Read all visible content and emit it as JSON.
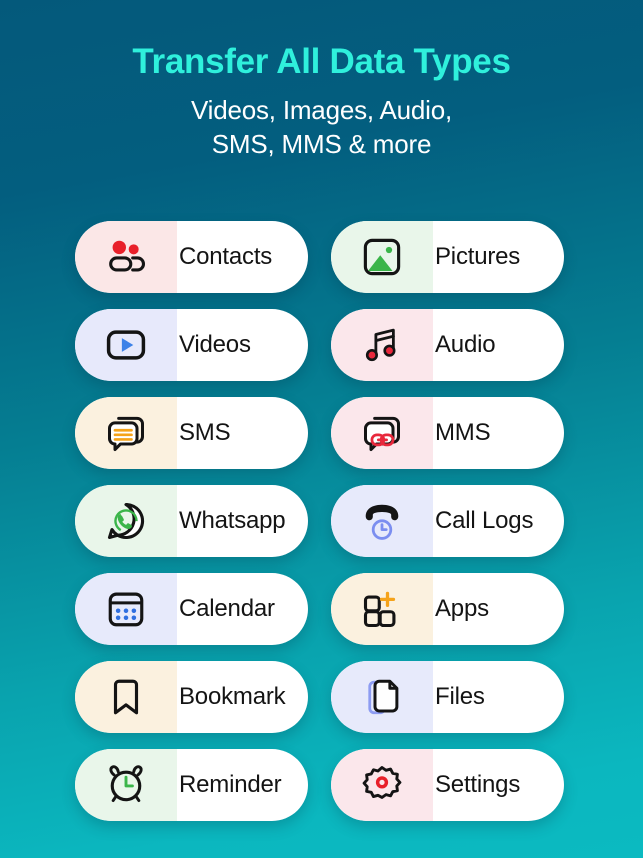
{
  "header": {
    "title": "Transfer All Data Types",
    "subtitle_line1": "Videos, Images, Audio,",
    "subtitle_line2": "SMS, MMS & more",
    "title_color": "#2ff0dc",
    "subtitle_color": "#ffffff"
  },
  "background": {
    "top_color": "#04597b",
    "bottom_color": "#0bbac1"
  },
  "cards": [
    {
      "label": "Contacts",
      "icon": "contacts-icon",
      "icon_bg": "#fbe7e7",
      "accent": "#e8202a"
    },
    {
      "label": "Pictures",
      "icon": "picture-icon",
      "icon_bg": "#e9f6ea",
      "accent": "#3bb54a"
    },
    {
      "label": "Videos",
      "icon": "video-play-icon",
      "icon_bg": "#e7e9fb",
      "accent": "#3d82e8"
    },
    {
      "label": "Audio",
      "icon": "music-note-icon",
      "icon_bg": "#fbe7eb",
      "accent": "#e8283c"
    },
    {
      "label": "SMS",
      "icon": "sms-icon",
      "icon_bg": "#fbf1df",
      "accent": "#f5a31a"
    },
    {
      "label": "MMS",
      "icon": "mms-link-icon",
      "icon_bg": "#fbe7eb",
      "accent": "#e8283c"
    },
    {
      "label": "Whatsapp",
      "icon": "whatsapp-icon",
      "icon_bg": "#e9f6ea",
      "accent": "#3bb54a"
    },
    {
      "label": "Call Logs",
      "icon": "call-log-icon",
      "icon_bg": "#e7eafb",
      "accent": "#7b8ef0"
    },
    {
      "label": "Calendar",
      "icon": "calendar-icon",
      "icon_bg": "#e7eafb",
      "accent": "#2f6fe0"
    },
    {
      "label": "Apps",
      "icon": "apps-plus-icon",
      "icon_bg": "#fbf1df",
      "accent": "#f5a31a"
    },
    {
      "label": "Bookmark",
      "icon": "bookmark-icon",
      "icon_bg": "#fbf1df",
      "accent": "#141414"
    },
    {
      "label": "Files",
      "icon": "files-icon",
      "icon_bg": "#e7eafb",
      "accent": "#8d9cf2"
    },
    {
      "label": "Reminder",
      "icon": "alarm-clock-icon",
      "icon_bg": "#e9f6ea",
      "accent": "#3bb54a"
    },
    {
      "label": "Settings",
      "icon": "settings-gear-icon",
      "icon_bg": "#fbe7eb",
      "accent": "#e8202a"
    }
  ]
}
